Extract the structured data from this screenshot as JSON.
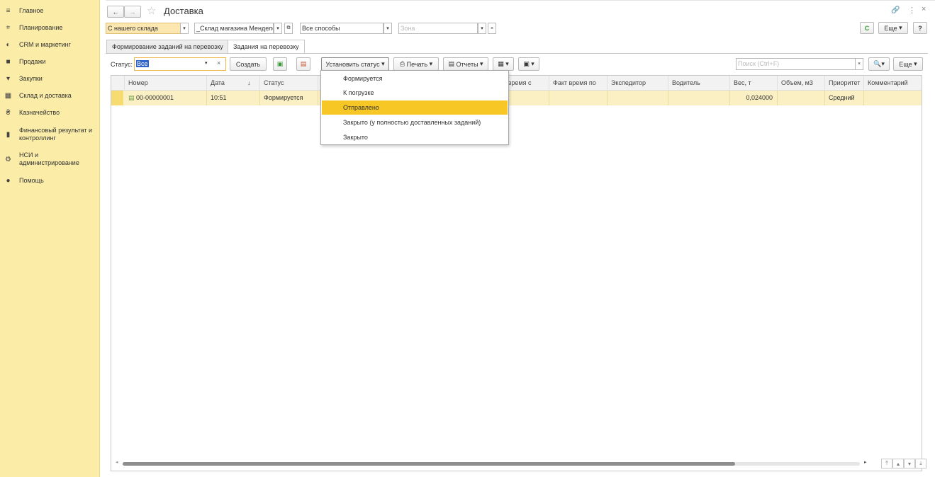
{
  "sidebar": {
    "items": [
      {
        "label": "Главное",
        "icon": "menu-icon"
      },
      {
        "label": "Планирование",
        "icon": "planning-icon"
      },
      {
        "label": "CRM и маркетинг",
        "icon": "crm-icon"
      },
      {
        "label": "Продажи",
        "icon": "bag-icon"
      },
      {
        "label": "Закупки",
        "icon": "cart-icon"
      },
      {
        "label": "Склад и доставка",
        "icon": "warehouse-icon"
      },
      {
        "label": "Казначейство",
        "icon": "treasury-icon"
      },
      {
        "label": "Финансовый результат и контроллинг",
        "icon": "chart-icon"
      },
      {
        "label": "НСИ и администрирование",
        "icon": "gear-icon"
      },
      {
        "label": "Помощь",
        "icon": "help-icon"
      }
    ]
  },
  "header": {
    "back": "←",
    "forward": "→",
    "star": "☆",
    "title": "Доставка",
    "link": "🔗",
    "more": "⋮",
    "close": "×"
  },
  "filters": {
    "source": "С нашего склада",
    "warehouse": "_Склад магазина Менделеева",
    "method": "Все способы",
    "zone_placeholder": "Зона",
    "refresh": "C",
    "more": "Еще",
    "help": "?"
  },
  "tabs": [
    {
      "label": "Формирование заданий на перевозку"
    },
    {
      "label": "Задания на перевозку"
    }
  ],
  "toolbar": {
    "status_label": "Статус:",
    "status_value": "Все",
    "create": "Создать",
    "set_status": "Установить статус",
    "print": "Печать",
    "reports": "Отчеты",
    "search_placeholder": "Поиск (Ctrl+F)",
    "more": "Еще"
  },
  "table": {
    "columns": [
      "Номер",
      "Дата",
      "Статус",
      "",
      "т время с",
      "Факт время по",
      "Экспедитор",
      "Водитель",
      "Вес, т",
      "Объем, м3",
      "Приоритет",
      "Комментарий"
    ],
    "sort_arrow": "↓",
    "rows": [
      {
        "number": "00-00000001",
        "date": "10:51",
        "status": "Формируется",
        "weight": "0,024000",
        "priority": "Средний"
      }
    ]
  },
  "status_menu": {
    "options": [
      "Формируется",
      "К погрузке",
      "Отправлено",
      "Закрыто (у полностью доставленных заданий)",
      "Закрыто"
    ],
    "selected": "Отправлено"
  },
  "colors": {
    "sidebar": "#fbeda8",
    "highlight": "#f7c825",
    "row": "#fbf0c4"
  }
}
